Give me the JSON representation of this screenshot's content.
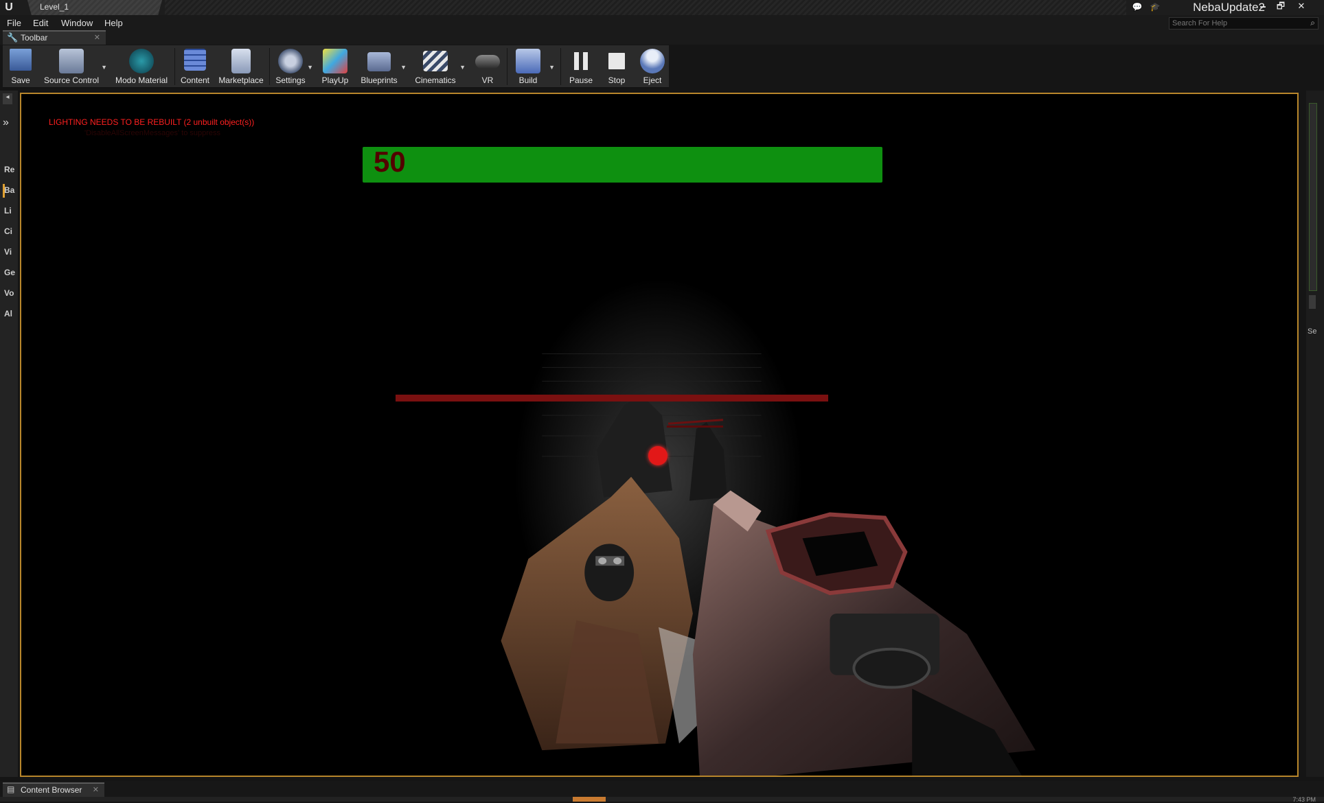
{
  "window": {
    "tab_title": "Level_1",
    "project_name": "NebaUpdate2",
    "minimize_glyph": "🗕",
    "restore_glyph": "🗗",
    "close_glyph": "✕"
  },
  "menu": {
    "items": [
      "File",
      "Edit",
      "Window",
      "Help"
    ],
    "help_search_placeholder": "Search For Help"
  },
  "toolbar_tab": {
    "label": "Toolbar",
    "close": "✕"
  },
  "toolbar": {
    "buttons": [
      {
        "label": "Save",
        "icon": "save-icon"
      },
      {
        "label": "Source Control",
        "icon": "source-control-icon"
      },
      {
        "label": "Modo Material",
        "icon": "modo-material-icon"
      },
      {
        "label": "Content",
        "icon": "content-icon"
      },
      {
        "label": "Marketplace",
        "icon": "marketplace-icon"
      },
      {
        "label": "Settings",
        "icon": "settings-icon"
      },
      {
        "label": "PlayUp",
        "icon": "playup-icon"
      },
      {
        "label": "Blueprints",
        "icon": "blueprints-icon"
      },
      {
        "label": "Cinematics",
        "icon": "cinematics-icon"
      },
      {
        "label": "VR",
        "icon": "vr-icon"
      },
      {
        "label": "Build",
        "icon": "build-icon"
      },
      {
        "label": "Pause",
        "icon": "pause-icon"
      },
      {
        "label": "Stop",
        "icon": "stop-icon"
      },
      {
        "label": "Eject",
        "icon": "eject-icon"
      }
    ]
  },
  "left_panel": {
    "tabs": [
      "Re",
      "Ba",
      "Li",
      "Ci",
      "Vi",
      "Ge",
      "Vo",
      "Al"
    ]
  },
  "viewport": {
    "lighting_warning": "LIGHTING NEEDS TO BE REBUILT (2 unbuilt object(s))",
    "lighting_sub": "'DisableAllScreenMessages' to suppress",
    "player_health": "50",
    "colors": {
      "health_bar": "#0e9010",
      "health_text": "#520000",
      "warning": "#ff2020",
      "crosshair": "#e21818",
      "viewport_border": "#b8862b"
    }
  },
  "right_panel": {
    "label": "Se"
  },
  "bottom": {
    "content_browser_label": "Content Browser",
    "close": "✕",
    "clock": "7:43 PM"
  }
}
